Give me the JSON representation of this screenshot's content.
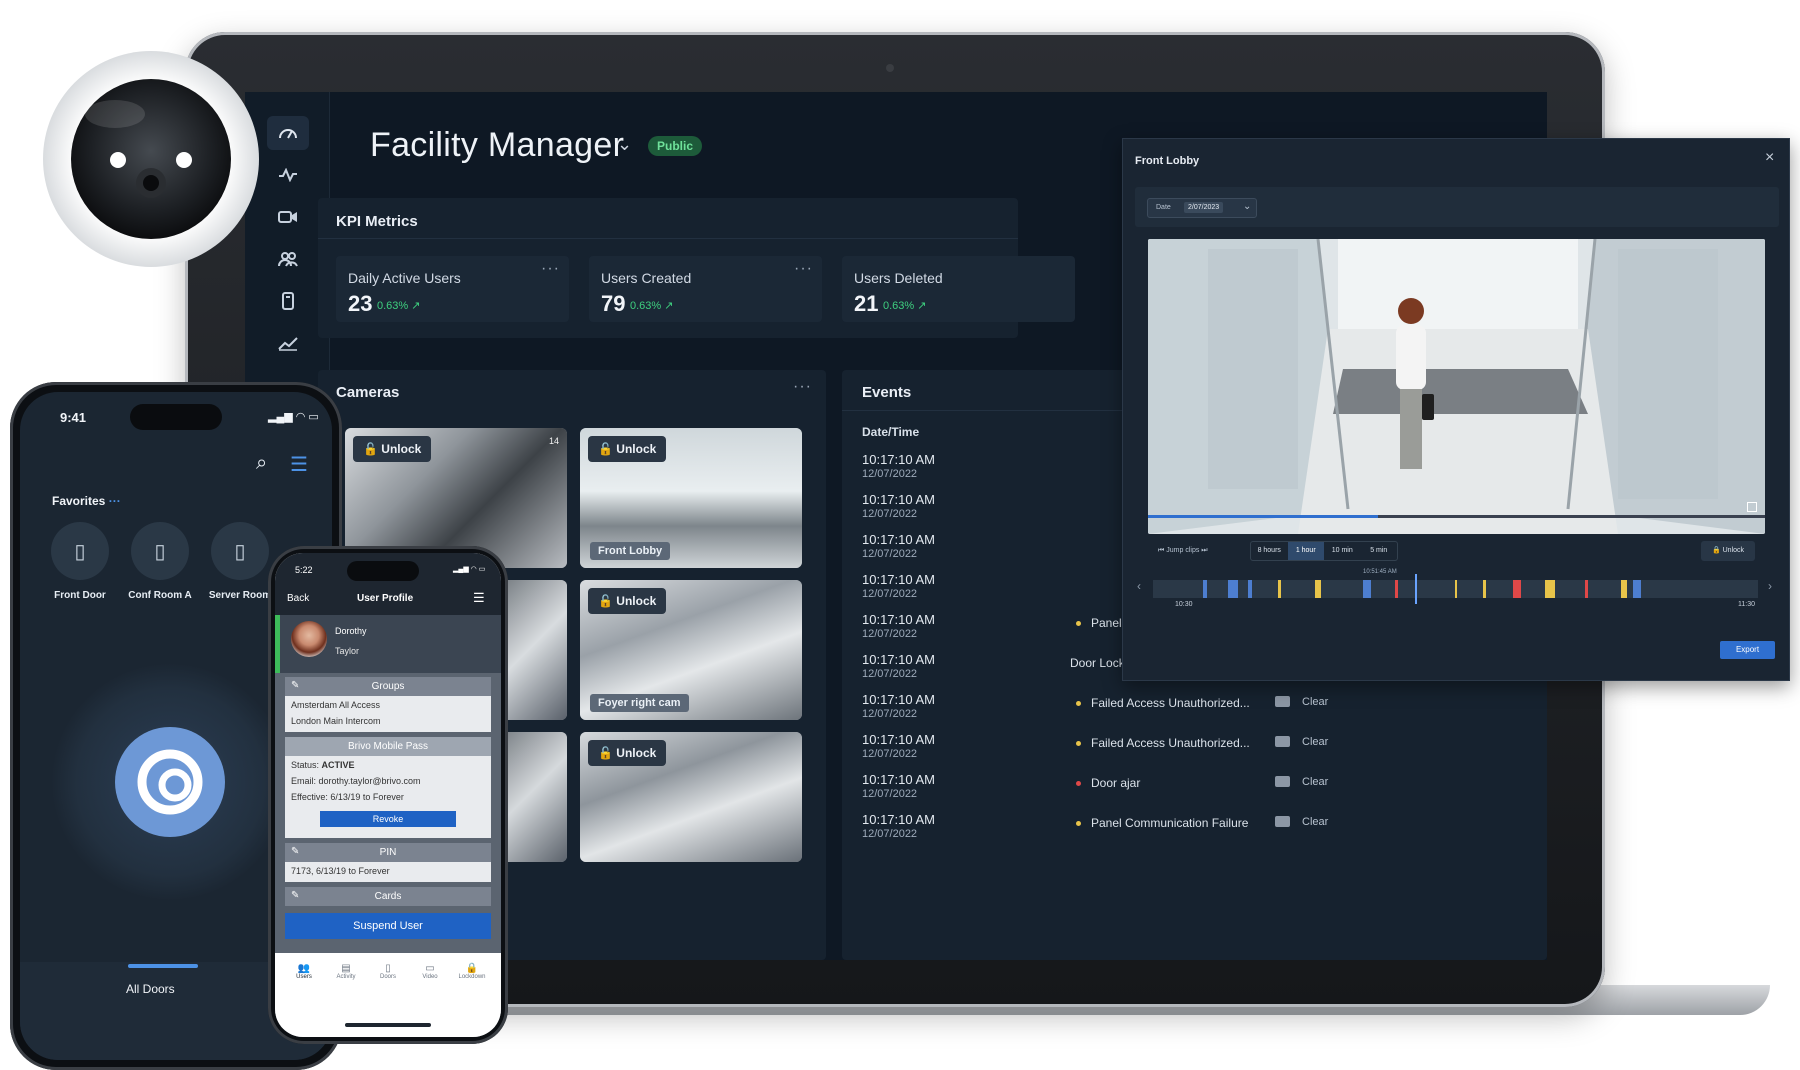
{
  "app": {
    "title": "Facility Manager",
    "badge": "Public"
  },
  "kpi": {
    "title": "KPI Metrics",
    "cards": [
      {
        "label": "Daily Active Users",
        "value": "23",
        "change": "0.63%"
      },
      {
        "label": "Users Created",
        "value": "79",
        "change": "0.63%"
      },
      {
        "label": "Users Deleted",
        "value": "21",
        "change": "0.63%"
      }
    ]
  },
  "cameras": {
    "title": "Cameras",
    "unlock_label": "Unlock",
    "tiles": [
      {
        "label": "",
        "stamp": "14"
      },
      {
        "label": "Front Lobby"
      },
      {
        "label": ""
      },
      {
        "label": "Foyer right cam"
      },
      {
        "label": ""
      },
      {
        "label": ""
      }
    ]
  },
  "events": {
    "title": "Events",
    "col_datetime": "Date/Time",
    "clear_label": "Clear",
    "rows": [
      {
        "time": "10:17:10 AM",
        "date": "12/07/2022",
        "name": "",
        "status": ""
      },
      {
        "time": "10:17:10 AM",
        "date": "12/07/2022",
        "name": "",
        "status": ""
      },
      {
        "time": "10:17:10 AM",
        "date": "12/07/2022",
        "name": "",
        "status": ""
      },
      {
        "time": "10:17:10 AM",
        "date": "12/07/2022",
        "name": "",
        "status": ""
      },
      {
        "time": "10:17:10 AM",
        "date": "12/07/2022",
        "name": "Panel Communication Failure",
        "status": "warning"
      },
      {
        "time": "10:17:10 AM",
        "date": "12/07/2022",
        "name": "Door Locked Via Schedule",
        "status": ""
      },
      {
        "time": "10:17:10 AM",
        "date": "12/07/2022",
        "name": "Failed Access Unauthorized...",
        "status": "warning"
      },
      {
        "time": "10:17:10 AM",
        "date": "12/07/2022",
        "name": "Failed Access Unauthorized...",
        "status": "warning"
      },
      {
        "time": "10:17:10 AM",
        "date": "12/07/2022",
        "name": "Door ajar",
        "status": "alert"
      },
      {
        "time": "10:17:10 AM",
        "date": "12/07/2022",
        "name": "Panel Communication Failure",
        "status": "warning"
      }
    ]
  },
  "modal": {
    "title": "Front Lobby",
    "date_label": "Date",
    "date_value": "2/07/2023",
    "jump_label": "Jump clips",
    "ranges": [
      "8 hours",
      "1 hour",
      "10 min",
      "5 min"
    ],
    "active_range": "1 hour",
    "unlock_label": "Unlock",
    "playhead_time": "10:51:45 AM",
    "tl_start": "10:30",
    "tl_end": "11:30",
    "export_label": "Export"
  },
  "phone1": {
    "time": "9:41",
    "favorites_label": "Favorites",
    "favorites": [
      "Front Door",
      "Conf Room A",
      "Server Room"
    ],
    "all_doors": "All Doors"
  },
  "phone2": {
    "time": "5:22",
    "back": "Back",
    "title": "User Profile",
    "first_name": "Dorothy",
    "last_name": "Taylor",
    "groups_title": "Groups",
    "groups": [
      "Amsterdam All Access",
      "London Main Intercom"
    ],
    "pass_title": "Brivo Mobile Pass",
    "status_label": "Status:",
    "status_value": "ACTIVE",
    "email": "Email: dorothy.taylor@brivo.com",
    "effective": "Effective: 6/13/19 to Forever",
    "revoke": "Revoke",
    "pin_title": "PIN",
    "pin_value": "7173, 6/13/19 to Forever",
    "cards_title": "Cards",
    "suspend": "Suspend User",
    "nav": [
      "Users",
      "Activity",
      "Doors",
      "Video",
      "Lockdown"
    ]
  },
  "colors": {
    "accent": "#2f6fcf",
    "positive": "#3ecf7f",
    "warning": "#e8c44a",
    "alert": "#e04848",
    "bg": "#0e1824"
  }
}
